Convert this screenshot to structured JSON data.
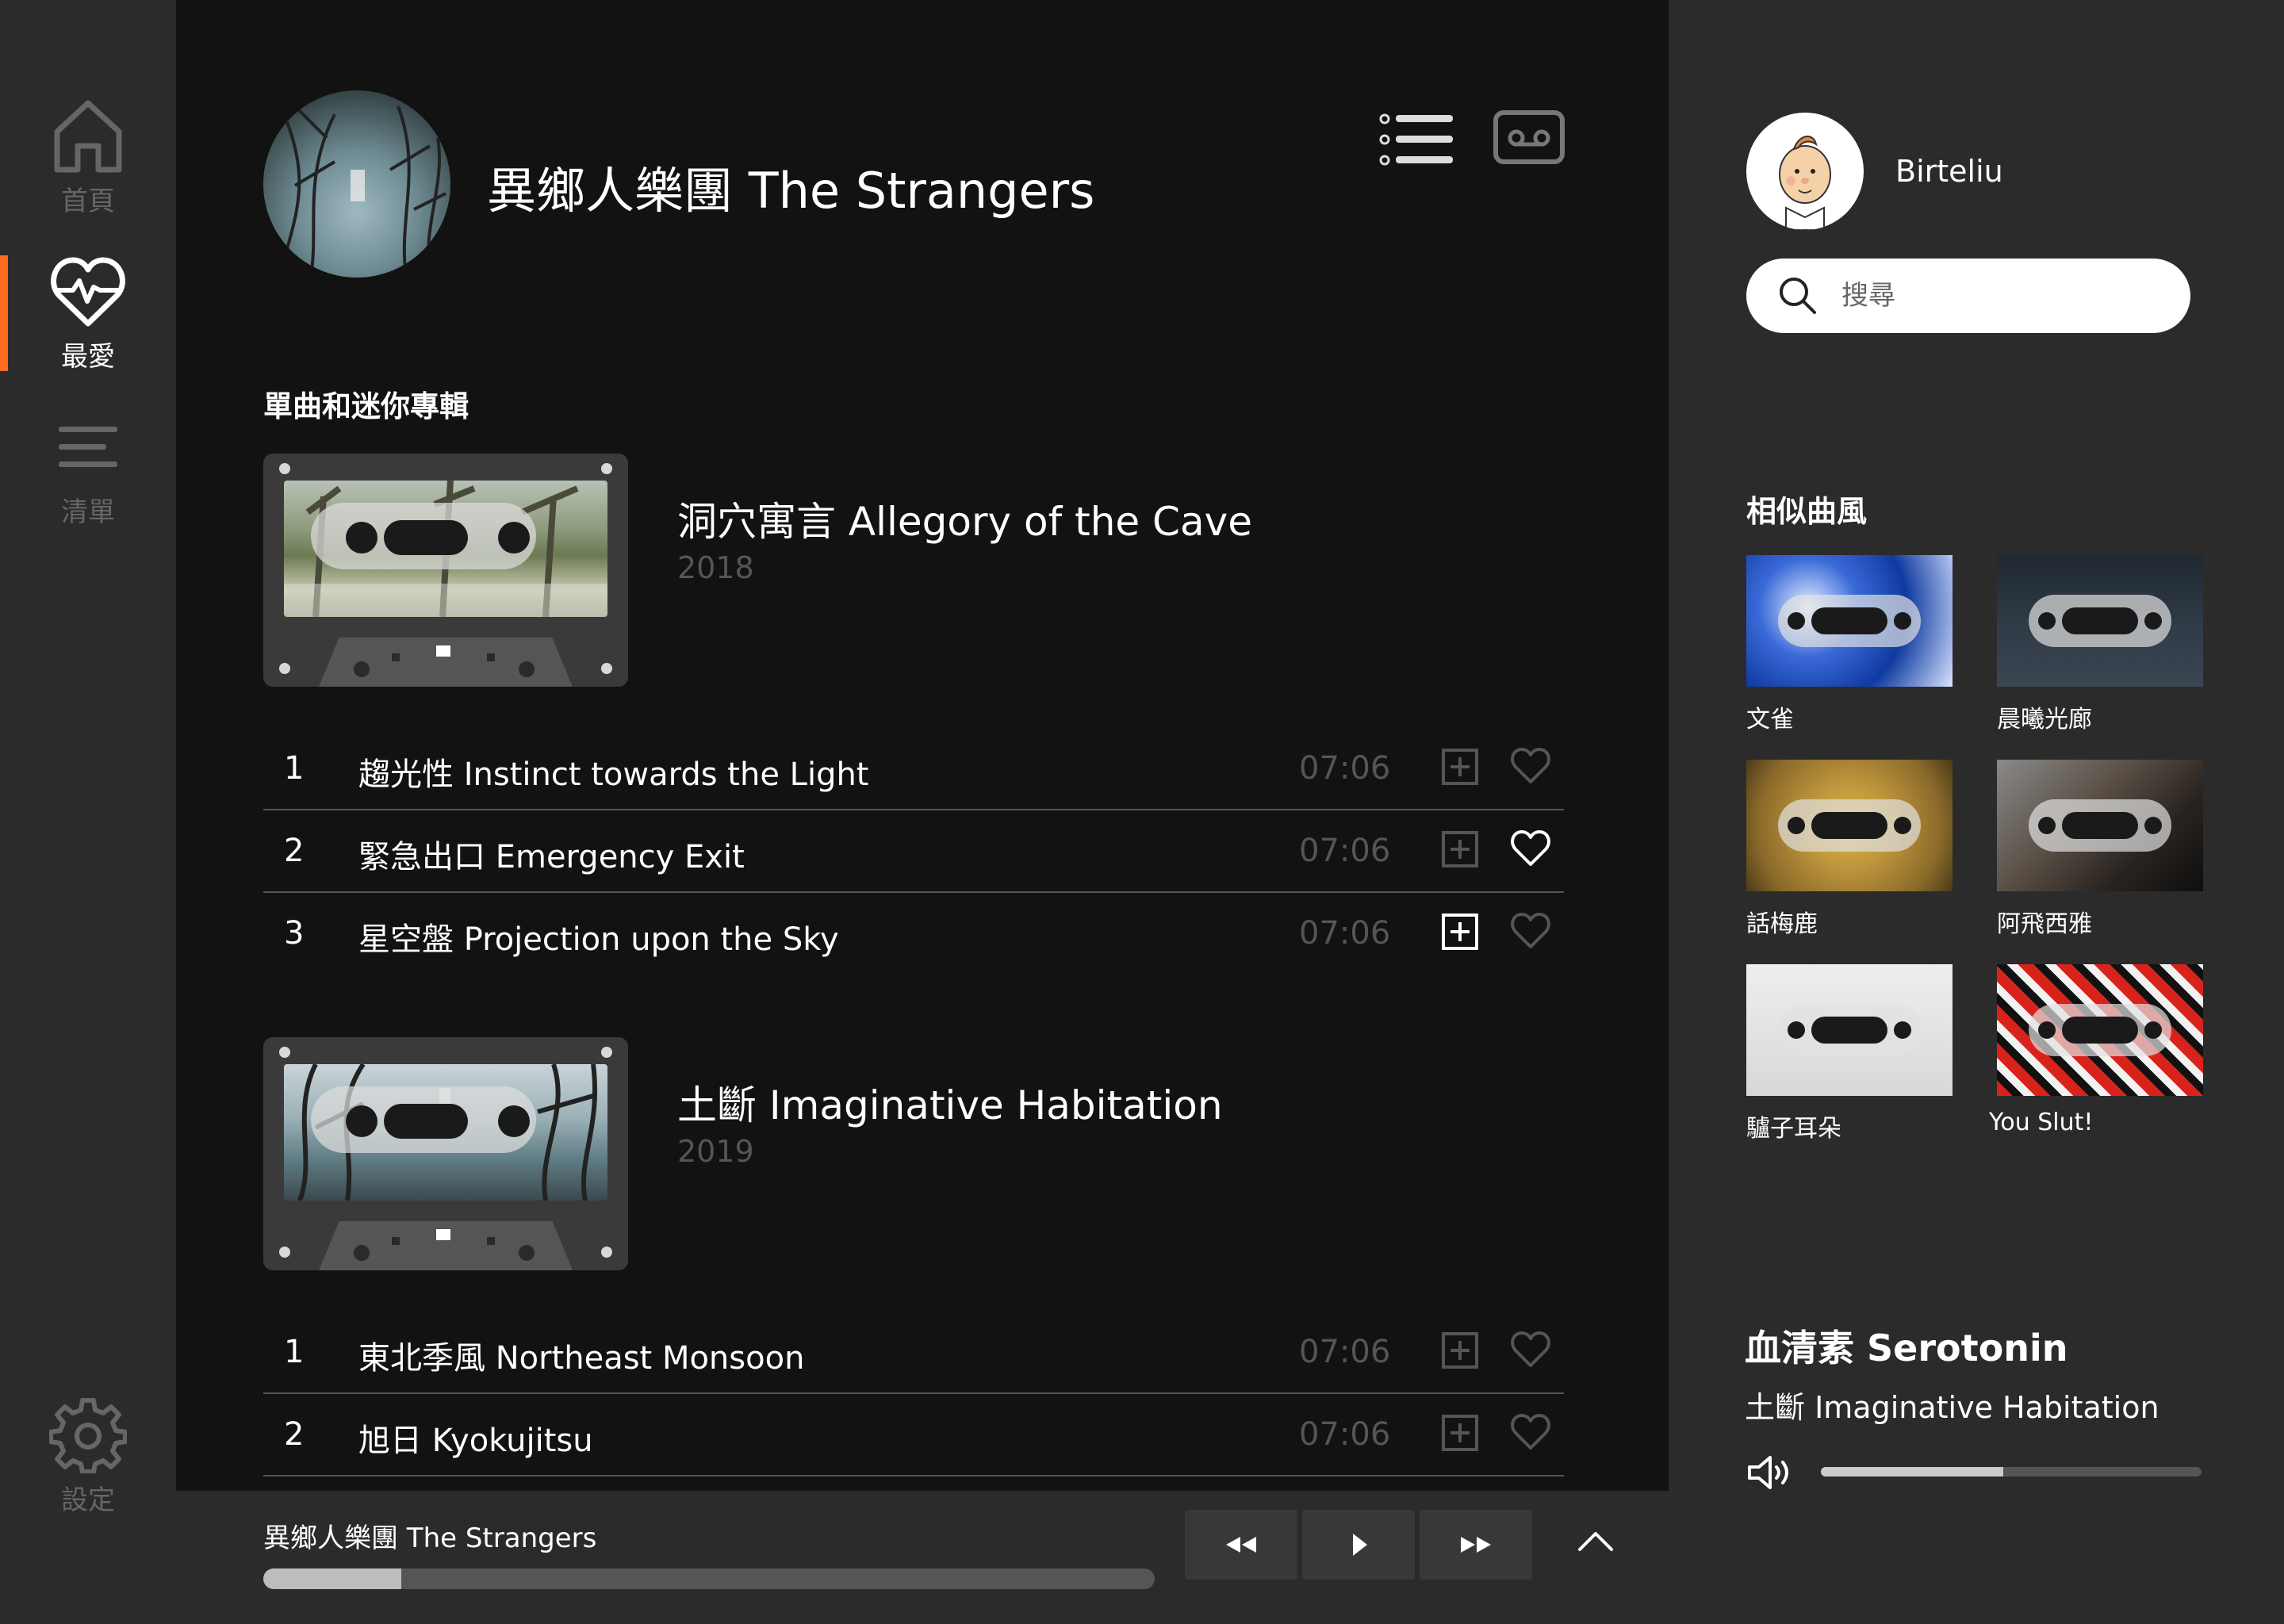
{
  "nav": {
    "home_label": "首頁",
    "favorites_label": "最愛",
    "playlist_label": "清單",
    "settings_label": "設定",
    "active": "favorites",
    "accent_color": "#ff6a21"
  },
  "artist": {
    "name": "異鄉人樂團 The Strangers",
    "avatar_icon": "artist-photo"
  },
  "view_toggle": {
    "list_icon": "list-icon",
    "cassette_icon": "cassette-icon"
  },
  "section_title": "單曲和迷你專輯",
  "albums": [
    {
      "title": "洞穴寓言 Allegory of the Cave",
      "year": "2018",
      "tracks": [
        {
          "num": "1",
          "title": "趨光性 Instinct towards the Light",
          "duration": "07:06",
          "added": false,
          "favorite": false
        },
        {
          "num": "2",
          "title": "緊急出口 Emergency Exit",
          "duration": "07:06",
          "added": false,
          "favorite": true
        },
        {
          "num": "3",
          "title": "星空盤 Projection upon the Sky",
          "duration": "07:06",
          "added": true,
          "favorite": false
        }
      ]
    },
    {
      "title": "土斷 Imaginative Habitation",
      "year": "2019",
      "tracks": [
        {
          "num": "1",
          "title": "東北季風 Northeast Monsoon",
          "duration": "07:06",
          "added": false,
          "favorite": false
        },
        {
          "num": "2",
          "title": "旭日 Kyokujitsu",
          "duration": "07:06",
          "added": false,
          "favorite": false
        }
      ]
    }
  ],
  "user": {
    "name": "Birteliu",
    "avatar_icon": "user-avatar"
  },
  "search": {
    "placeholder": "搜尋"
  },
  "similar": {
    "title": "相似曲風",
    "items": [
      {
        "name": "文雀"
      },
      {
        "name": "晨曦光廊"
      },
      {
        "name": "話梅鹿"
      },
      {
        "name": "阿飛西雅"
      },
      {
        "name": "驢子耳朵"
      },
      {
        "name": "You Slut!"
      }
    ]
  },
  "now_playing": {
    "song": "血清素 Serotonin",
    "album": "土斷 Imaginative Habitation",
    "volume": 0.48
  },
  "player": {
    "artist": "異鄉人樂團 The Strangers",
    "progress": 0.155,
    "rewind_icon": "rewind-icon",
    "play_icon": "play-icon",
    "forward_icon": "fast-forward-icon",
    "expand_icon": "chevron-up-icon"
  }
}
